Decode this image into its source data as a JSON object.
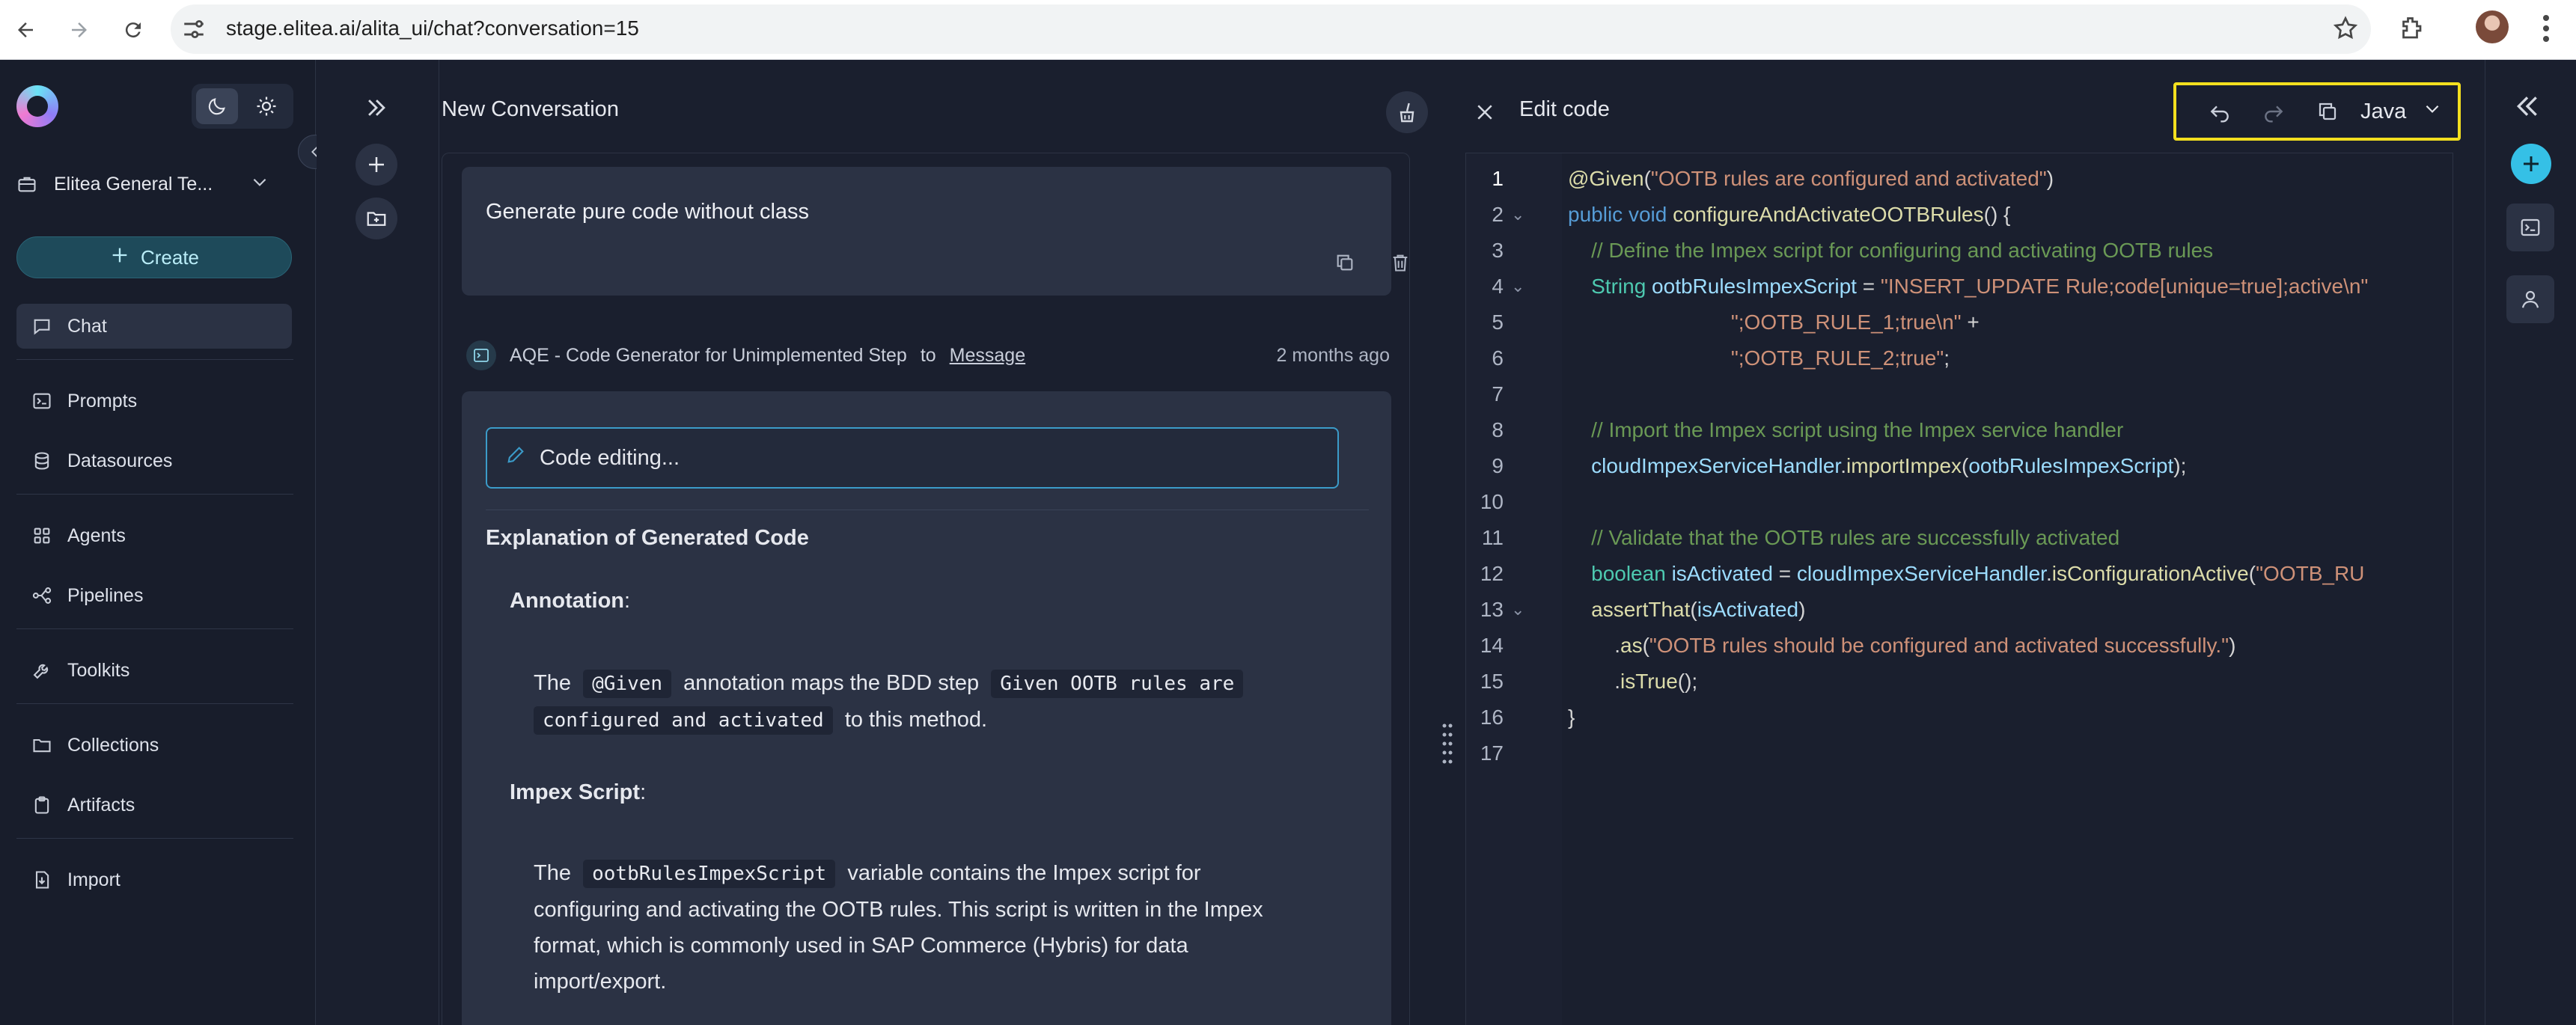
{
  "browser": {
    "url_host": "stage.elitea.ai",
    "url_path": "/alita_ui/chat?conversation=15"
  },
  "sidebar": {
    "team_name": "Elitea General Te...",
    "create_label": "Create",
    "items": [
      {
        "label": "Chat",
        "icon": "chat-icon",
        "active": true
      },
      {
        "label": "Prompts",
        "icon": "terminal-icon"
      },
      {
        "label": "Datasources",
        "icon": "database-icon"
      },
      {
        "label": "Agents",
        "icon": "grid-icon"
      },
      {
        "label": "Pipelines",
        "icon": "pipeline-icon"
      },
      {
        "label": "Toolkits",
        "icon": "wrench-icon"
      },
      {
        "label": "Collections",
        "icon": "folder-icon"
      },
      {
        "label": "Artifacts",
        "icon": "clipboard-icon"
      },
      {
        "label": "Import",
        "icon": "import-icon"
      }
    ]
  },
  "chat": {
    "title": "New Conversation",
    "user_message": "Generate pure code without class",
    "bot": {
      "name": "AQE - Code Generator for Unimplemented Step",
      "to": "to",
      "target": "Message",
      "time": "2 months ago",
      "code_editing": "Code editing...",
      "heading": "Explanation of Generated Code",
      "annotation_title": "Annotation",
      "ann_p1": "The",
      "ann_code1": "@Given",
      "ann_p2": "annotation maps the BDD step",
      "ann_code2a": "Given OOTB rules are",
      "ann_code2b": "configured and activated",
      "ann_p3": "to this method.",
      "impex_title": "Impex Script",
      "imp_p1": "The",
      "imp_code": "ootbRulesImpexScript",
      "imp_p2": "variable contains the Impex script for",
      "imp_line2": "configuring and activating the OOTB rules. This script is written in the Impex",
      "imp_line3": "format, which is commonly used in SAP Commerce (Hybris) for data",
      "imp_line4": "import/export."
    }
  },
  "editor": {
    "title": "Edit code",
    "language": "Java",
    "lines": [
      {
        "n": "1",
        "fold": false,
        "segs": [
          [
            "k-ann",
            "@Given"
          ],
          [
            "k-plain",
            "("
          ],
          [
            "k-str",
            "\"OOTB rules are configured and activated\""
          ],
          [
            "k-plain",
            ")"
          ]
        ]
      },
      {
        "n": "2",
        "fold": true,
        "segs": [
          [
            "k-kw",
            "public void "
          ],
          [
            "k-fn",
            "configureAndActivateOOTBRules"
          ],
          [
            "k-plain",
            "() {"
          ]
        ]
      },
      {
        "n": "3",
        "fold": false,
        "segs": [
          [
            "k-cm",
            "    // Define the Impex script for configuring and activating OOTB rules"
          ]
        ]
      },
      {
        "n": "4",
        "fold": true,
        "segs": [
          [
            "k-type",
            "    String "
          ],
          [
            "k-var",
            "ootbRulesImpexScript"
          ],
          [
            "k-plain",
            " = "
          ],
          [
            "k-str",
            "\"INSERT_UPDATE Rule;code[unique=true];active\\n\""
          ]
        ]
      },
      {
        "n": "5",
        "fold": false,
        "segs": [
          [
            "k-str",
            "                            \";OOTB_RULE_1;true\\n\""
          ],
          [
            "k-plain",
            " +"
          ]
        ]
      },
      {
        "n": "6",
        "fold": false,
        "segs": [
          [
            "k-str",
            "                            \";OOTB_RULE_2;true\""
          ],
          [
            "k-plain",
            ";"
          ]
        ]
      },
      {
        "n": "7",
        "fold": false,
        "segs": []
      },
      {
        "n": "8",
        "fold": false,
        "segs": [
          [
            "k-cm",
            "    // Import the Impex script using the Impex service handler"
          ]
        ]
      },
      {
        "n": "9",
        "fold": false,
        "segs": [
          [
            "k-var",
            "    cloudImpexServiceHandler"
          ],
          [
            "k-plain",
            "."
          ],
          [
            "k-fn",
            "importImpex"
          ],
          [
            "k-plain",
            "("
          ],
          [
            "k-var",
            "ootbRulesImpexScript"
          ],
          [
            "k-plain",
            ");"
          ]
        ]
      },
      {
        "n": "10",
        "fold": false,
        "segs": []
      },
      {
        "n": "11",
        "fold": false,
        "segs": [
          [
            "k-cm",
            "    // Validate that the OOTB rules are successfully activated"
          ]
        ]
      },
      {
        "n": "12",
        "fold": false,
        "segs": [
          [
            "k-type",
            "    boolean "
          ],
          [
            "k-var",
            "isActivated"
          ],
          [
            "k-plain",
            " = "
          ],
          [
            "k-var",
            "cloudImpexServiceHandler"
          ],
          [
            "k-plain",
            "."
          ],
          [
            "k-fn",
            "isConfigurationActive"
          ],
          [
            "k-plain",
            "("
          ],
          [
            "k-str",
            "\"OOTB_RU"
          ]
        ]
      },
      {
        "n": "13",
        "fold": true,
        "segs": [
          [
            "k-fn",
            "    assertThat"
          ],
          [
            "k-plain",
            "("
          ],
          [
            "k-var",
            "isActivated"
          ],
          [
            "k-plain",
            ")"
          ]
        ]
      },
      {
        "n": "14",
        "fold": false,
        "segs": [
          [
            "k-plain",
            "        ."
          ],
          [
            "k-fn",
            "as"
          ],
          [
            "k-plain",
            "("
          ],
          [
            "k-str",
            "\"OOTB rules should be configured and activated successfully.\""
          ],
          [
            "k-plain",
            ")"
          ]
        ]
      },
      {
        "n": "15",
        "fold": false,
        "segs": [
          [
            "k-plain",
            "        ."
          ],
          [
            "k-fn",
            "isTrue"
          ],
          [
            "k-plain",
            "();"
          ]
        ]
      },
      {
        "n": "16",
        "fold": false,
        "segs": [
          [
            "k-plain",
            "}"
          ]
        ]
      },
      {
        "n": "17",
        "fold": false,
        "segs": []
      }
    ]
  },
  "colors": {
    "accent": "#35c0e6",
    "toolbar_highlight": "#f3df1f",
    "background": "#1a1f2e",
    "card": "#2b3244"
  }
}
